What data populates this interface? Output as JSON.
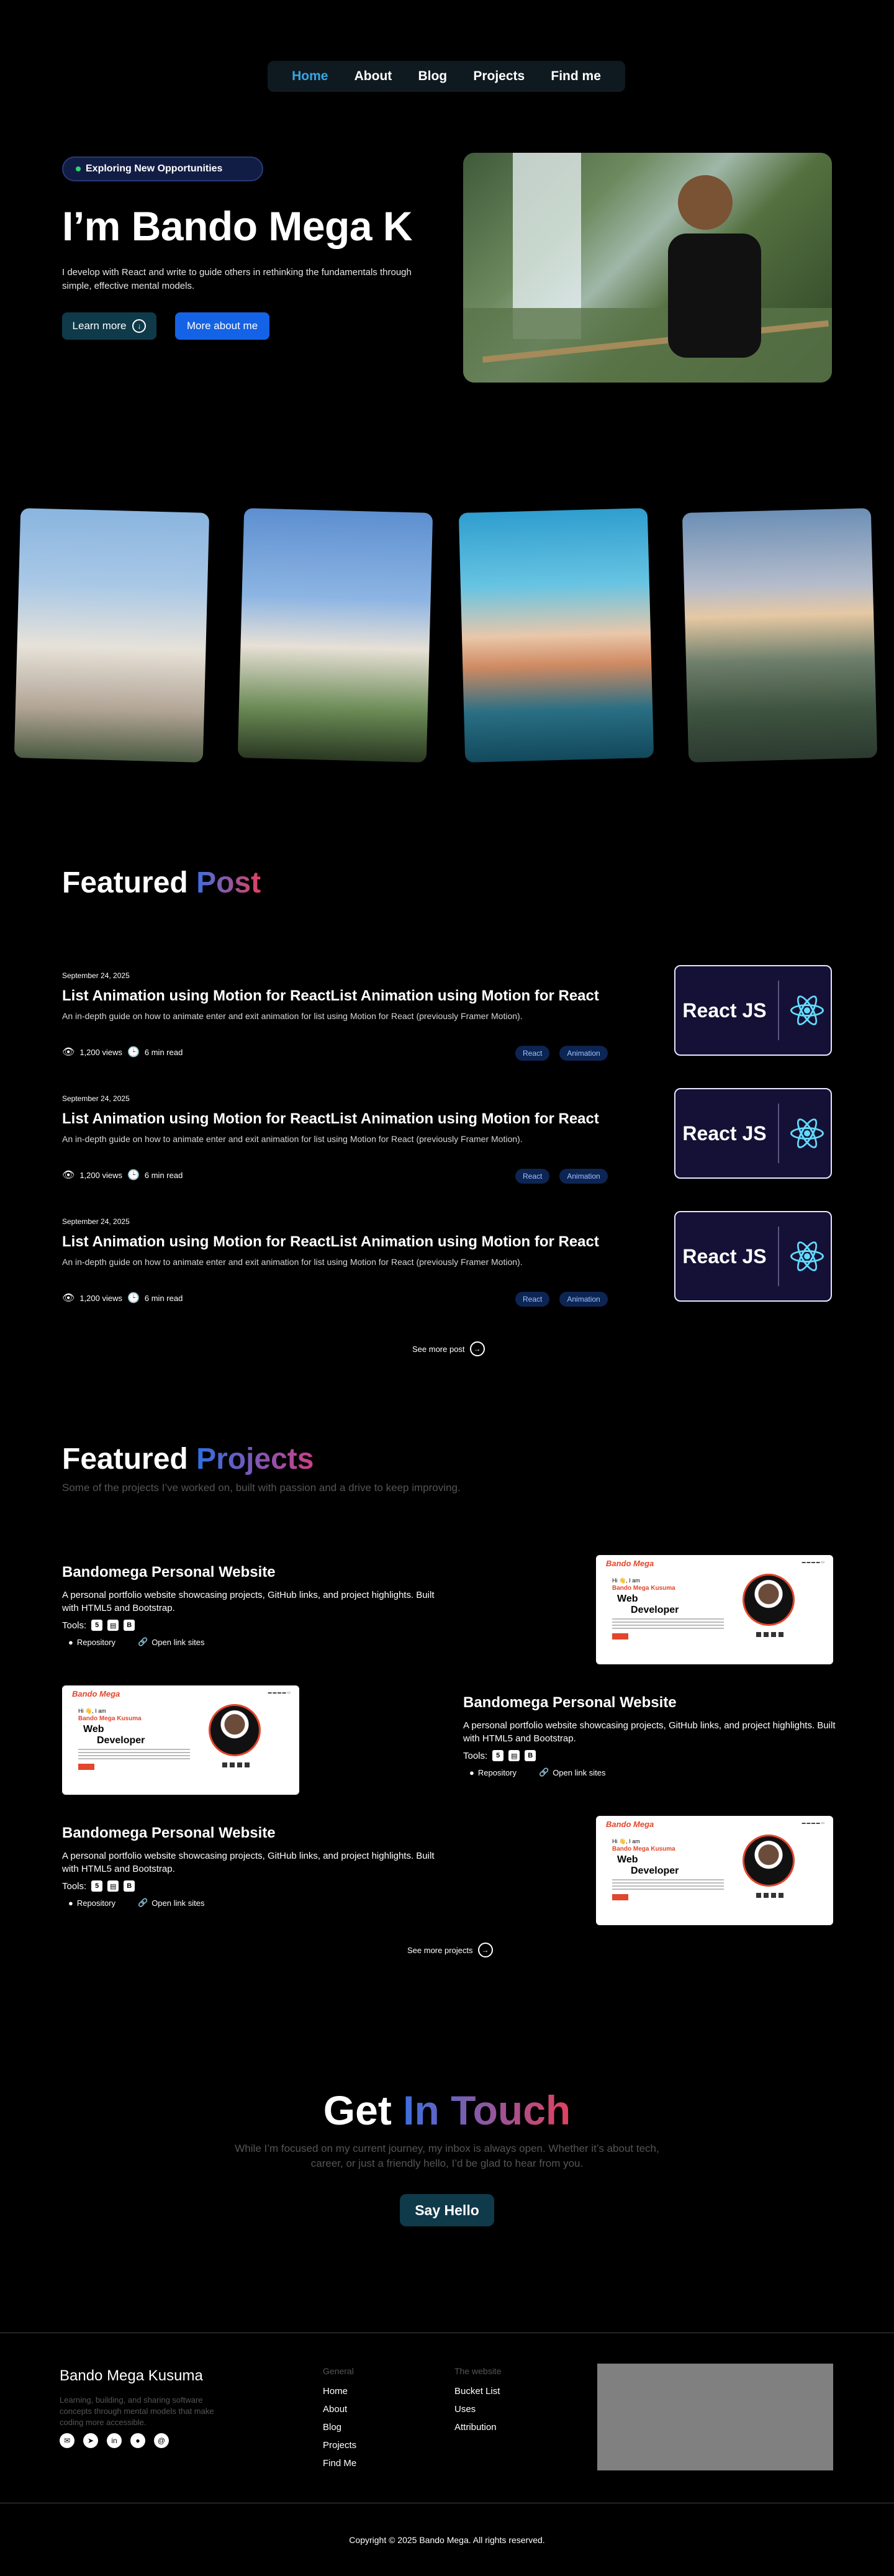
{
  "nav": {
    "items": [
      "Home",
      "About",
      "Blog",
      "Projects",
      "Find me"
    ],
    "active": "Home"
  },
  "hero": {
    "badge": "Exploring New Opportunities",
    "title": "I’m Bando Mega K",
    "description": "I develop with React and write to guide others in rethinking the fundamentals through simple, effective mental models.",
    "learn_more": "Learn more",
    "more_about": "More about me"
  },
  "featured_post": {
    "title_plain": "Featured",
    "title_accent": "Post",
    "posts": [
      {
        "date": "September 24, 2025",
        "title": "List Animation using Motion for ReactList Animation using Motion for React",
        "description": "An in-depth guide on how to animate enter and exit animation for list using Motion for React (previously Framer Motion).",
        "views": "1,200 views",
        "read": "6 min read",
        "tags": [
          "React",
          "Animation"
        ],
        "thumb_label": "React JS"
      },
      {
        "date": "September 24, 2025",
        "title": "List Animation using Motion for ReactList Animation using Motion for React",
        "description": "An in-depth guide on how to animate enter and exit animation for list using Motion for React (previously Framer Motion).",
        "views": "1,200 views",
        "read": "6 min read",
        "tags": [
          "React",
          "Animation"
        ],
        "thumb_label": "React JS"
      },
      {
        "date": "September 24, 2025",
        "title": "List Animation using Motion for ReactList Animation using Motion for React",
        "description": "An in-depth guide on how to animate enter and exit animation for list using Motion for React (previously Framer Motion).",
        "views": "1,200 views",
        "read": "6 min read",
        "tags": [
          "React",
          "Animation"
        ],
        "thumb_label": "React JS"
      }
    ],
    "see_more": "See more post"
  },
  "featured_projects": {
    "title_plain": "Featured",
    "title_accent": "Projects",
    "subtitle": "Some of the projects I’ve worked on, built with passion and a drive to keep improving.",
    "projects": [
      {
        "name": "Bandomega Personal Website",
        "description": "A personal portfolio website showcasing projects, GitHub links, and project highlights. Built with HTML5 and Bootstrap.",
        "tools_label": "Tools:",
        "repository": "Repository",
        "open_link": "Open link sites"
      },
      {
        "name": "Bandomega Personal Website",
        "description": "A personal portfolio website showcasing projects, GitHub links, and project highlights. Built with HTML5 and Bootstrap.",
        "tools_label": "Tools:",
        "repository": "Repository",
        "open_link": "Open link sites"
      },
      {
        "name": "Bandomega Personal Website",
        "description": "A personal portfolio website showcasing projects, GitHub links, and project highlights. Built with HTML5 and Bootstrap.",
        "tools_label": "Tools:",
        "repository": "Repository",
        "open_link": "Open link sites"
      }
    ],
    "preview": {
      "logo": "Bando Mega",
      "greeting": "Hi 👋, I am",
      "name": "Bando Mega Kusuma",
      "line1": "Web",
      "line2": "Developer"
    },
    "see_more": "See more projects"
  },
  "contact": {
    "title_plain": "Get",
    "title_accent": "In Touch",
    "description": "While I’m focused on my current journey, my inbox is always open. Whether it’s about tech, career, or just a friendly hello, I’d be glad to hear from you.",
    "button": "Say Hello"
  },
  "footer": {
    "brand": "Bando Mega Kusuma",
    "tagline": "Learning, building, and sharing software concepts through mental models that make coding more accessible.",
    "general_head": "General",
    "general_items": [
      "Home",
      "About",
      "Blog",
      "Projects",
      "Find Me"
    ],
    "website_head": "The website",
    "website_items": [
      "Bucket List",
      "Uses",
      "Attribution"
    ],
    "copyright": "Copyright © 2025 Bando Mega. All rights reserved."
  },
  "colors": {
    "accent_blue": "#1463e6",
    "active_nav": "#36a7e6",
    "tag_bg": "#0d2553",
    "button_teal": "#0f3a4a"
  },
  "icons": [
    "arrow-down-icon",
    "eye-icon",
    "clock-icon",
    "arrow-right-icon",
    "github-icon",
    "link-icon",
    "mail-icon",
    "telegram-icon",
    "linkedin-icon",
    "threads-icon"
  ]
}
